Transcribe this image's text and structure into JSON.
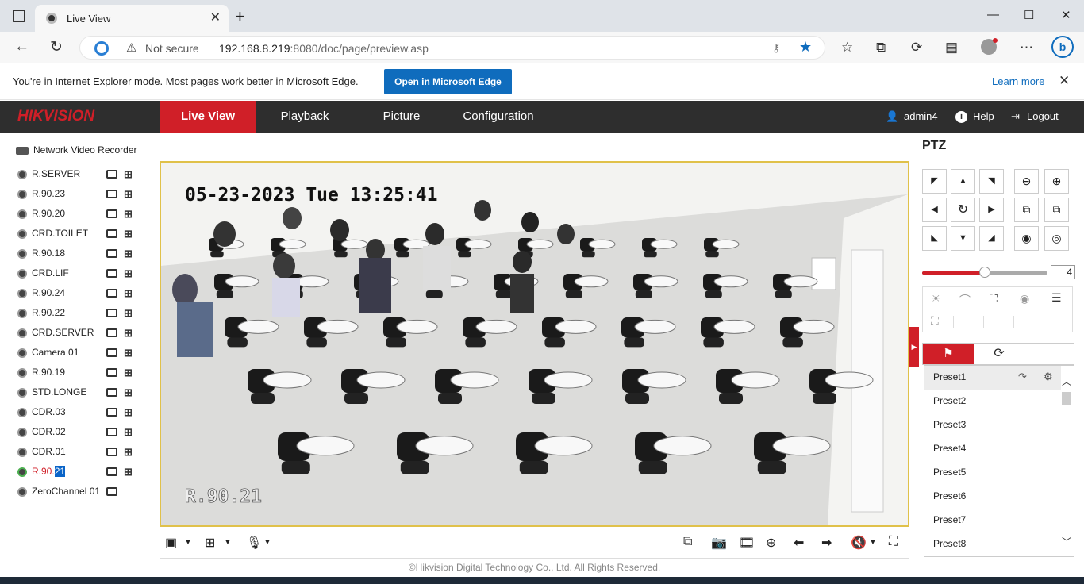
{
  "browser": {
    "tab_title": "Live View",
    "tab_close": "✕",
    "new_tab": "+",
    "address": {
      "security_label": "Not secure",
      "url_host": "192.168.8.219",
      "url_rest": ":8080/doc/page/preview.asp"
    },
    "ie_mode": {
      "message": "You're in Internet Explorer mode. Most pages work better in Microsoft Edge.",
      "open_button": "Open in Microsoft Edge",
      "learn_more": "Learn more"
    }
  },
  "nav": {
    "logo": "HIKVISION",
    "items": [
      {
        "label": "Live View",
        "active": true
      },
      {
        "label": "Playback",
        "active": false
      },
      {
        "label": "Picture",
        "active": false
      },
      {
        "label": "Configuration",
        "active": false
      }
    ],
    "user": "admin4",
    "help": "Help",
    "logout": "Logout"
  },
  "tree": {
    "root": "Network Video Recorder",
    "cameras": [
      "R.SERVER",
      "R.90.23",
      "R.90.20",
      "CRD.TOILET",
      "R.90.18",
      "CRD.LIF",
      "R.90.24",
      "R.90.22",
      "CRD.SERVER",
      "Camera 01",
      "R.90.19",
      "STD.LONGE",
      "CDR.03",
      "CDR.02",
      "CDR.01"
    ],
    "selected_camera_prefix": "R.90.",
    "selected_camera_highlight": "21",
    "zero_channel": "ZeroChannel 01"
  },
  "video": {
    "timestamp": "05-23-2023 Tue 13:25:41",
    "channel_label": "R.90.21"
  },
  "footer": "©Hikvision Digital Technology Co., Ltd. All Rights Reserved.",
  "ptz": {
    "title": "PTZ",
    "speed": "4",
    "speed_fraction": 0.5,
    "presets": [
      "Preset1",
      "Preset2",
      "Preset3",
      "Preset4",
      "Preset5",
      "Preset6",
      "Preset7",
      "Preset8"
    ]
  },
  "colors": {
    "brand_red": "#d01f28",
    "nav_bg": "#2e2e2e",
    "edge_blue": "#0f6cbd"
  }
}
